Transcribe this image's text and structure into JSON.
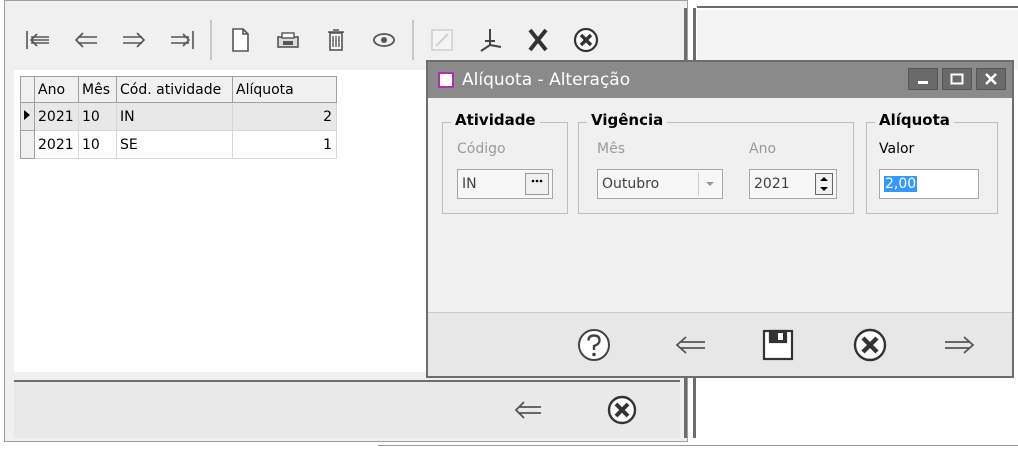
{
  "grid": {
    "columns": [
      "Ano",
      "Mês",
      "Cód. atividade",
      "Alíquota"
    ],
    "rows": [
      {
        "ano": "2021",
        "mes": "10",
        "cod": "IN",
        "aliquota": "2"
      },
      {
        "ano": "2021",
        "mes": "10",
        "cod": "SE",
        "aliquota": "1"
      }
    ]
  },
  "dialog": {
    "title": "Alíquota - Alteração",
    "atividade": {
      "group_label": "Atividade",
      "codigo_label": "Código",
      "codigo_value": "IN"
    },
    "vigencia": {
      "group_label": "Vigência",
      "mes_label": "Mês",
      "mes_value": "Outubro",
      "ano_label": "Ano",
      "ano_value": "2021"
    },
    "aliquota": {
      "group_label": "Alíquota",
      "valor_label": "Valor",
      "valor_value": "2,00"
    }
  },
  "icons": {
    "toolbar": [
      "first-record-icon",
      "previous-record-icon",
      "next-record-icon",
      "last-record-icon",
      "new-document-icon",
      "print-icon",
      "delete-icon",
      "view-icon",
      "edit-icon",
      "pdf-icon",
      "excel-icon",
      "close-icon"
    ],
    "dialog_footer": [
      "help-icon",
      "previous-icon",
      "save-icon",
      "cancel-icon",
      "next-icon"
    ],
    "bottom_bar": [
      "previous-icon",
      "close-icon"
    ]
  },
  "colors": {
    "title_bar": "#8a8a8a",
    "accent_select": "#3399ff",
    "app_icon_border": "#b030b0"
  }
}
